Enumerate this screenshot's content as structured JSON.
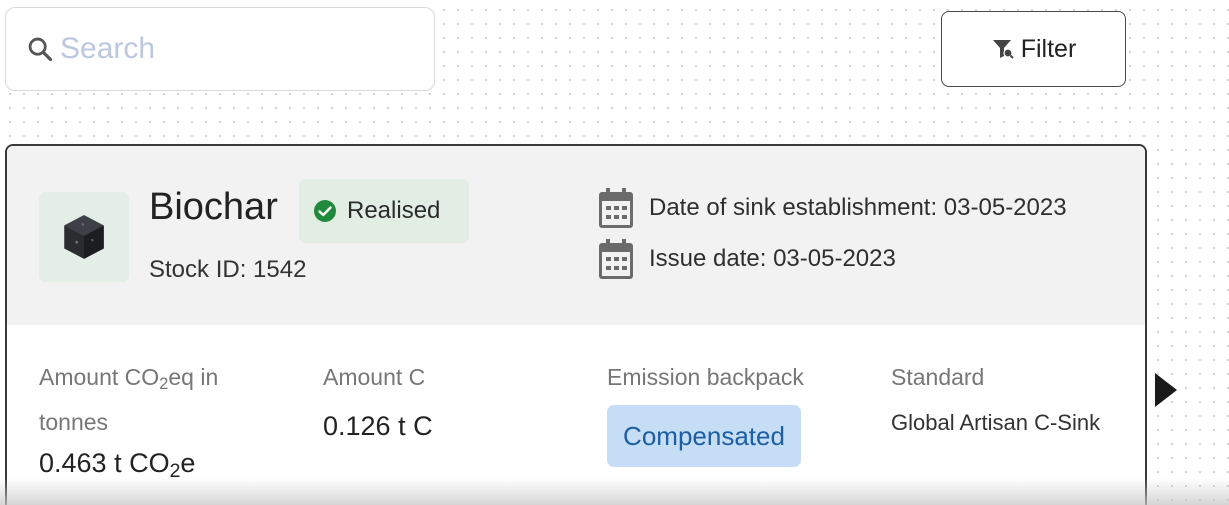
{
  "search": {
    "placeholder": "Search",
    "value": "",
    "icon": "search-icon"
  },
  "toolbar": {
    "filter_label": "Filter",
    "filter_icon": "filter-icon"
  },
  "card": {
    "product": "Biochar",
    "stock_id": "Stock ID: 1542",
    "status": {
      "label": "Realised",
      "icon": "check-circle-icon",
      "color": "#1f8a3b"
    },
    "date_sink": "Date of sink establishment: 03-05-2023",
    "date_issue": "Issue date: 03-05-2023",
    "metrics": {
      "co2_label_main": "Amount CO",
      "co2_label_sub": "2",
      "co2_label_tail": "eq in tonnes",
      "co2_value_main": "0.463 t CO",
      "co2_value_sub": "2",
      "co2_value_tail": "e",
      "carbon_label": "Amount C",
      "carbon_value": "0.126 t C",
      "emission_label": "Emission backpack",
      "emission_value": "Compensated",
      "standard_label": "Standard",
      "standard_value": "Global Artisan C-Sink"
    }
  },
  "colors": {
    "accent_blue": "#c6ddf6",
    "status_green_bg": "#e2eee4",
    "header_bg": "#f2f2f2"
  }
}
